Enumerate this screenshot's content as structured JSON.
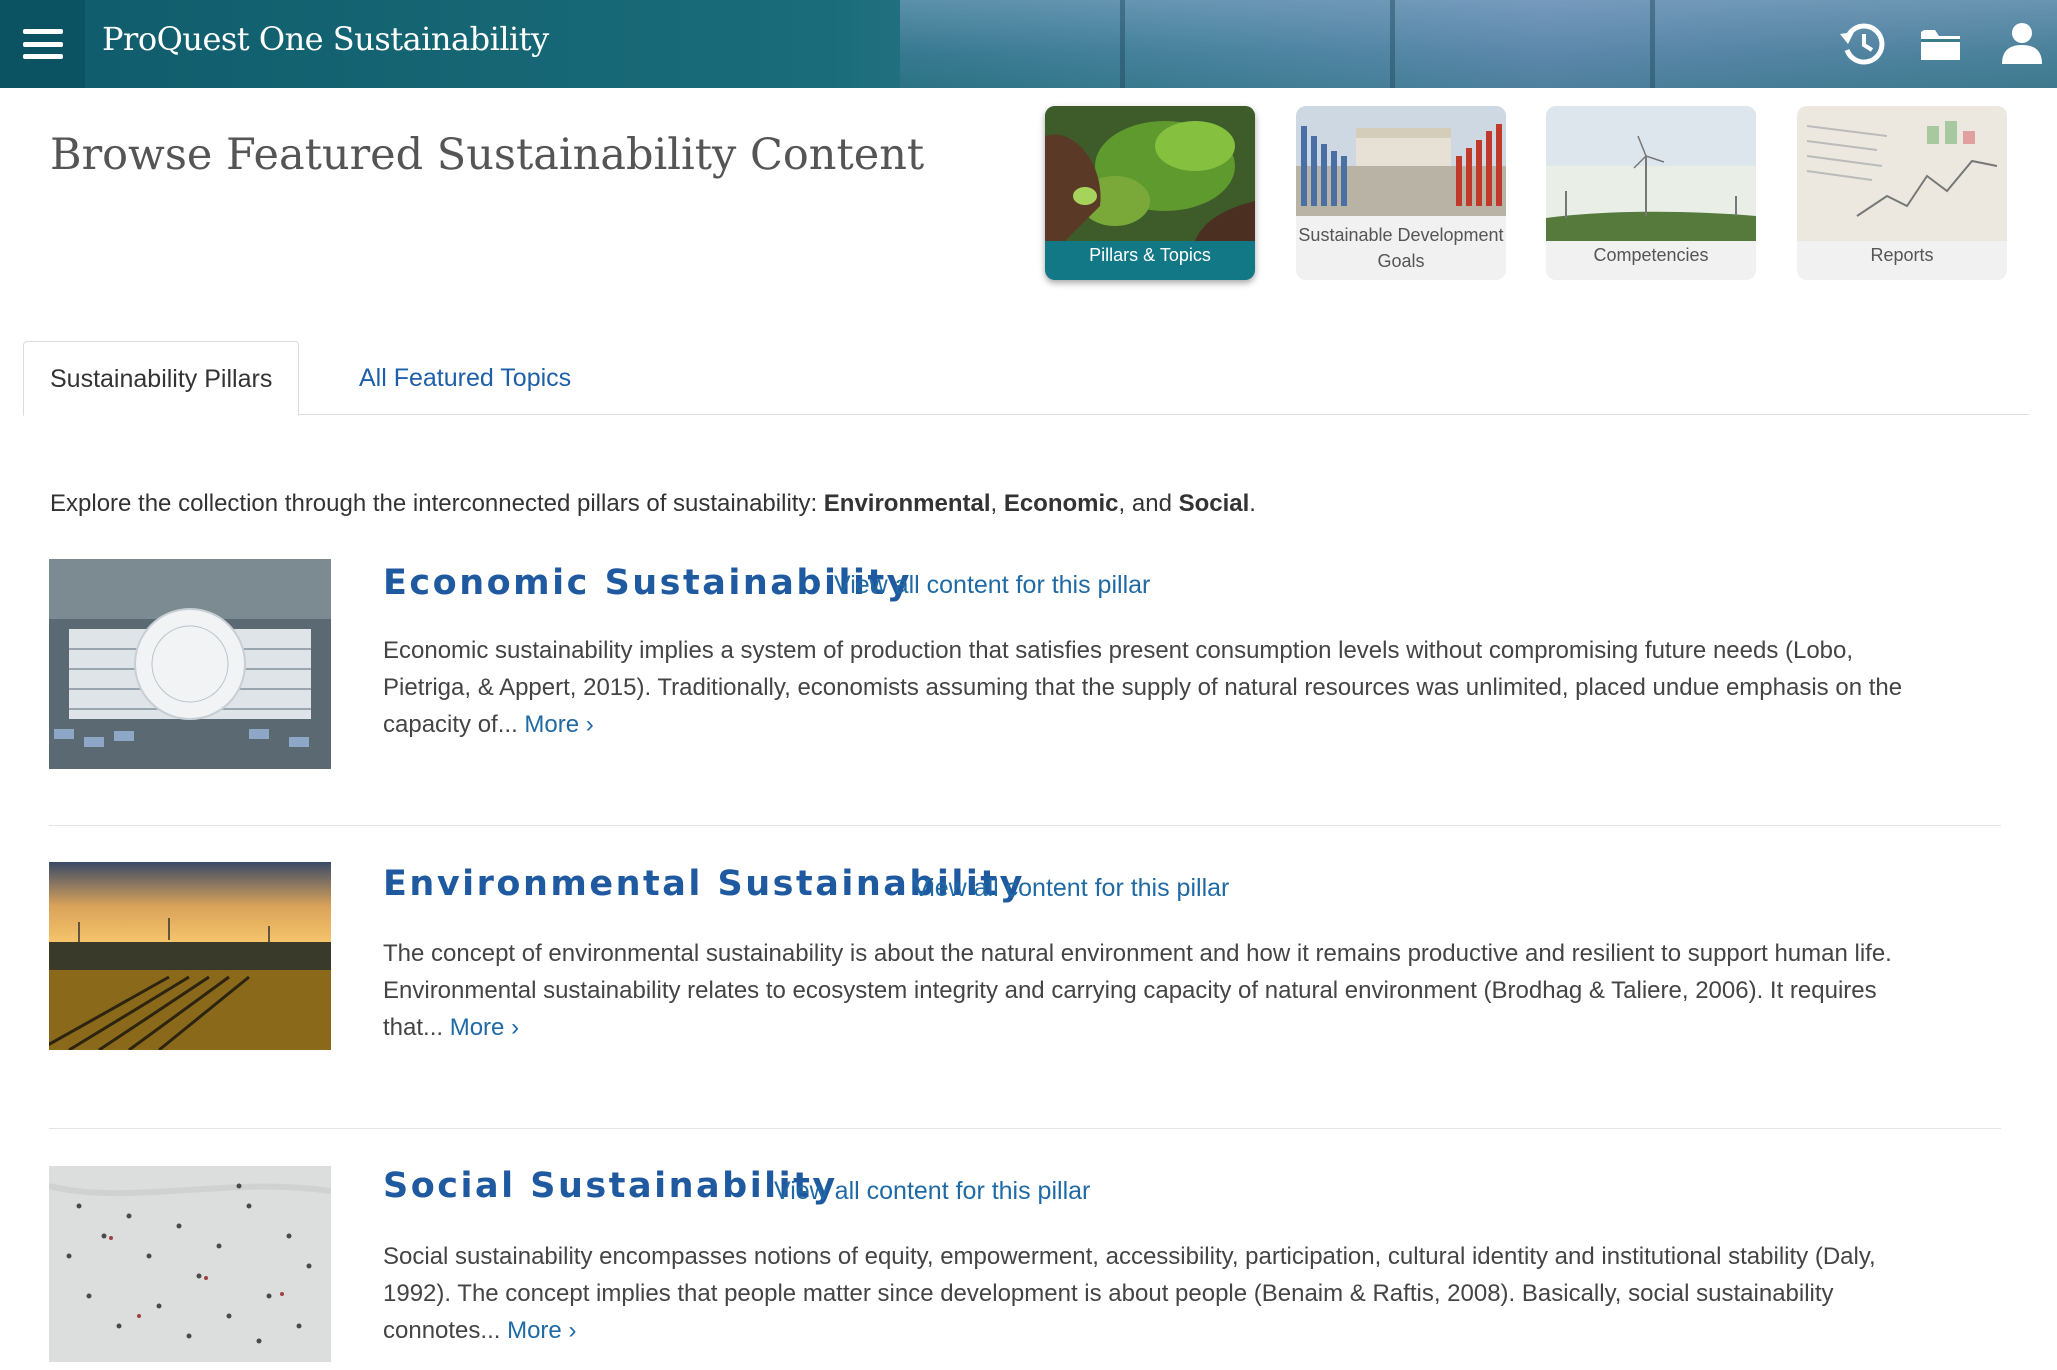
{
  "header": {
    "app_title": "ProQuest One Sustainability",
    "icons": [
      "menu-icon",
      "history-icon",
      "folder-icon",
      "user-icon"
    ]
  },
  "page": {
    "title": "Browse Featured Sustainability Content"
  },
  "categories": [
    {
      "label": "Pillars & Topics",
      "active": true
    },
    {
      "label_line1": "Sustainable Development",
      "label_line2": "Goals",
      "active": false
    },
    {
      "label": "Competencies",
      "active": false
    },
    {
      "label": "Reports",
      "active": false
    }
  ],
  "tabs": [
    {
      "label": "Sustainability Pillars",
      "active": true
    },
    {
      "label": "All Featured Topics",
      "active": false
    }
  ],
  "intro": {
    "prefix": "Explore the collection through the interconnected pillars of sustainability: ",
    "bold1": "Environmental",
    "sep1": ", ",
    "bold2": "Economic",
    "sep2": ", and ",
    "bold3": "Social",
    "suffix": "."
  },
  "pillars": [
    {
      "title": "Economic Sustainability",
      "link": "View all content for this pillar",
      "description": "Economic sustainability implies a system of production that satisfies present consumption levels without compromising future needs (Lobo, Pietriga, & Appert, 2015). Traditionally, economists assuming that the supply of natural resources was unlimited, placed undue emphasis on the capacity of...",
      "more": "More ›"
    },
    {
      "title": "Environmental Sustainability",
      "link": "View all content for this pillar",
      "description": "The concept of environmental sustainability is about the natural environment and how it remains productive and resilient to support human life. Environmental sustainability relates to ecosystem integrity and carrying capacity of natural environment (Brodhag & Taliere, 2006). It requires that...",
      "more": "More ›"
    },
    {
      "title": "Social Sustainability",
      "link": "View all content for this pillar",
      "description": "Social sustainability encompasses notions of equity, empowerment, accessibility, participation, cultural identity and institutional stability (Daly, 1992). The concept implies that people matter since development is about people (Benaim & Raftis, 2008). Basically, social sustainability connotes...",
      "more": "More ›"
    }
  ],
  "colors": {
    "header_bg": "#0f5c6b",
    "active_card": "#127885",
    "title_blue": "#1f5aa0",
    "link_blue": "#1f6aa5"
  }
}
